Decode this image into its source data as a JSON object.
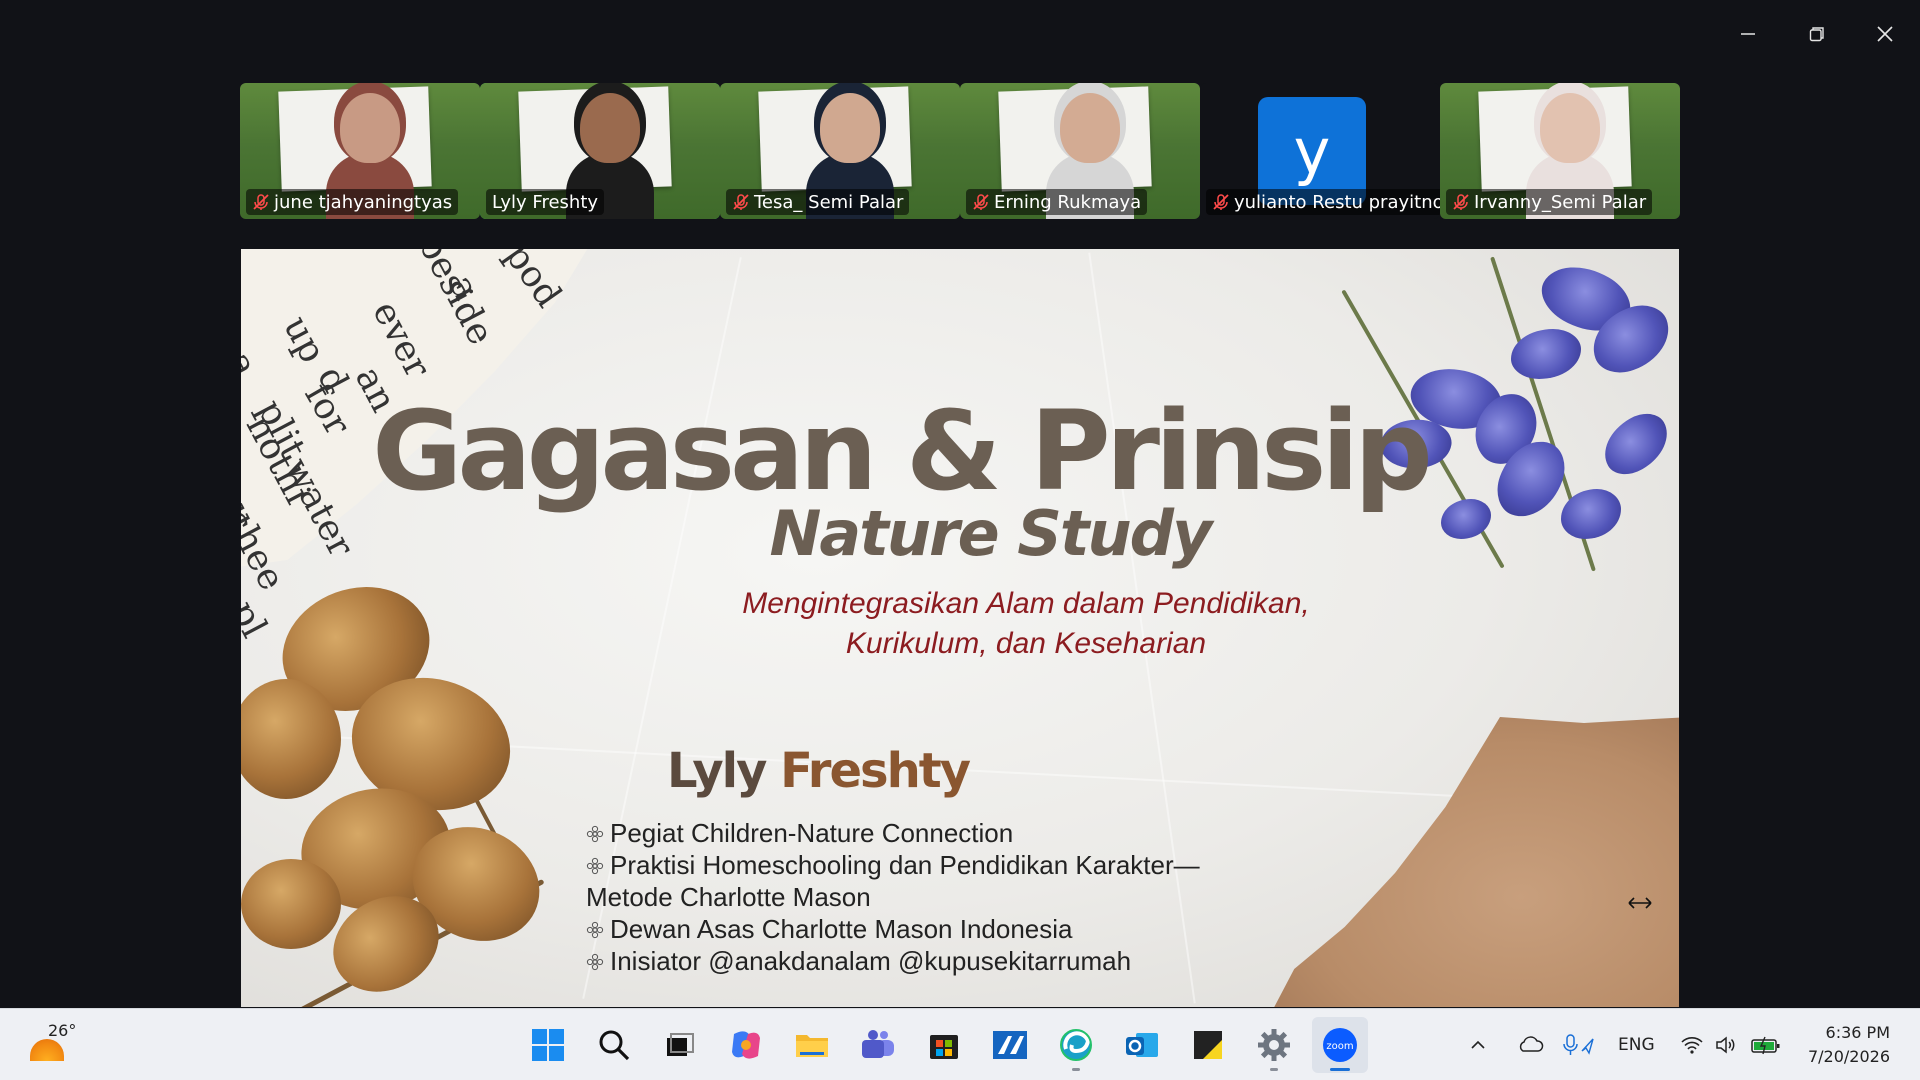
{
  "window_controls": {
    "minimize_icon": "minimize-icon",
    "restore_icon": "restore-icon",
    "close_icon": "close-icon"
  },
  "participants": [
    {
      "name": "june tjahyaningtyas",
      "muted": true,
      "active": false,
      "type": "video"
    },
    {
      "name": "Lyly Freshty",
      "muted": false,
      "active": true,
      "type": "video"
    },
    {
      "name": "Tesa_ Semi Palar",
      "muted": true,
      "active": false,
      "type": "video"
    },
    {
      "name": "Erning Rukmaya",
      "muted": true,
      "active": false,
      "type": "video"
    },
    {
      "name": "yulianto Restu prayitno",
      "muted": true,
      "active": false,
      "type": "avatar",
      "initial": "y"
    },
    {
      "name": "Irvanny_Semi Palar",
      "muted": true,
      "active": false,
      "type": "video"
    }
  ],
  "slide": {
    "title_line1": "Gagasan & Prinsip",
    "title_line2": "Nature Study",
    "subtitle_line1": "Mengintegrasikan Alam dalam Pendidikan,",
    "subtitle_line2": "Kurikulum, dan Keseharian",
    "speaker_first": "Lyly",
    "speaker_last": "Freshty",
    "bullets": [
      "Pegiat Children-Nature Connection",
      "Praktisi Homeschooling dan Pendidikan Karakter—",
      "Dewan Asas Charlotte Mason Indonesia",
      "Inisiator @anakdanalam @kupusekitarrumah"
    ],
    "bullet_continuation": "Metode Charlotte Mason",
    "scrap_words": [
      "beside",
      "a",
      "pod",
      "ever",
      "an",
      "up",
      "d",
      "for",
      "a",
      "plit",
      "nothi",
      "water",
      "ll",
      "chee",
      "pl"
    ],
    "colors": {
      "title": "#6b5f53",
      "subtitle": "#8c1c20",
      "speaker": "#8a5630"
    }
  },
  "taskbar": {
    "weather_temp": "26°",
    "apps": [
      {
        "name": "start",
        "icon": "windows-start-icon"
      },
      {
        "name": "search",
        "icon": "search-icon"
      },
      {
        "name": "task-view",
        "icon": "task-view-icon"
      },
      {
        "name": "copilot",
        "icon": "copilot-icon"
      },
      {
        "name": "file-explorer",
        "icon": "folder-icon"
      },
      {
        "name": "teams",
        "icon": "teams-icon"
      },
      {
        "name": "store",
        "icon": "store-icon"
      },
      {
        "name": "app-blue",
        "icon": "app-icon"
      },
      {
        "name": "edge",
        "icon": "edge-icon"
      },
      {
        "name": "outlook",
        "icon": "outlook-icon"
      },
      {
        "name": "sticky",
        "icon": "sticky-notes-icon"
      },
      {
        "name": "settings",
        "icon": "gear-icon"
      },
      {
        "name": "zoom",
        "icon": "zoom-icon",
        "label": "zoom"
      }
    ],
    "language": "ENG",
    "time": "6:36 PM",
    "date": "7/20/2026"
  }
}
